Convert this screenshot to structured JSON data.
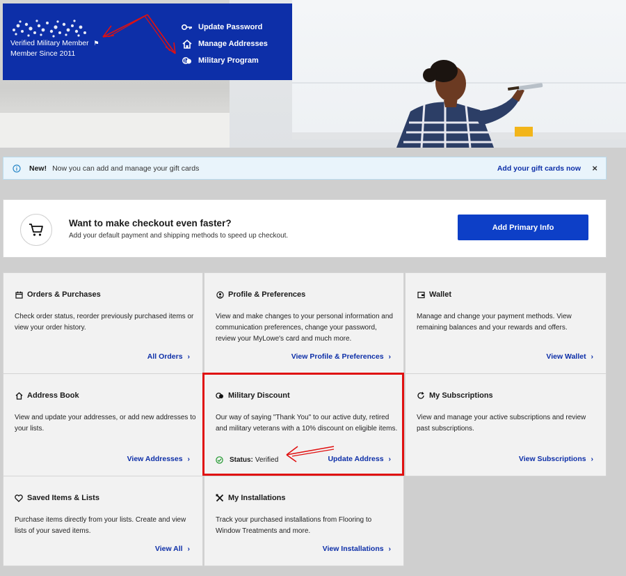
{
  "profile": {
    "member_status": "Verified Military Member",
    "member_since": "Member Since 2011",
    "links": [
      {
        "label": "Update Password",
        "icon": "key-icon"
      },
      {
        "label": "Manage Addresses",
        "icon": "home-icon"
      },
      {
        "label": "Military Program",
        "icon": "military-icon"
      }
    ]
  },
  "notice": {
    "badge": "New!",
    "message": "Now you can add and manage your gift cards",
    "link": "Add your gift cards now",
    "close": "×"
  },
  "checkout": {
    "title": "Want to make checkout even faster?",
    "subtitle": "Add your default payment and shipping methods to speed up checkout.",
    "button": "Add Primary Info"
  },
  "tiles": [
    {
      "title": "Orders & Purchases",
      "icon": "calendar-icon",
      "desc": "Check order status, reorder previously purchased items or view your order history.",
      "link": "All Orders"
    },
    {
      "title": "Profile & Preferences",
      "icon": "profile-icon",
      "desc": "View and make changes to your personal information and communication preferences, change your password, review your MyLowe's card and much more.",
      "link": "View Profile & Preferences"
    },
    {
      "title": "Wallet",
      "icon": "wallet-icon",
      "desc": "Manage and change your payment methods. View remaining balances and your rewards and offers.",
      "link": "View Wallet"
    },
    {
      "title": "Address Book",
      "icon": "home-icon",
      "desc": "View and update your addresses, or add new addresses to your lists.",
      "link": "View Addresses"
    },
    {
      "title": "Military Discount",
      "icon": "military-icon",
      "desc": "Our way of saying \"Thank You\" to our active duty, retired and military veterans with a 10% discount on eligible items.",
      "link": "Update Address",
      "status_label": "Status:",
      "status_value": "Verified"
    },
    {
      "title": "My Subscriptions",
      "icon": "subscription-icon",
      "desc": "View and manage your active subscriptions and review past subscriptions.",
      "link": "View Subscriptions"
    },
    {
      "title": "Saved Items & Lists",
      "icon": "heart-icon",
      "desc": "Purchase items directly from your lists. Create and view lists of your saved items.",
      "link": "View All"
    },
    {
      "title": "My Installations",
      "icon": "tools-icon",
      "desc": "Track your purchased installations from Flooring to Window Treatments and more.",
      "link": "View Installations"
    }
  ],
  "colors": {
    "brand_blue": "#0d2fa8",
    "button_blue": "#0d3fc7",
    "annotation_red": "#e01010",
    "verified_green": "#2e9e3a"
  }
}
